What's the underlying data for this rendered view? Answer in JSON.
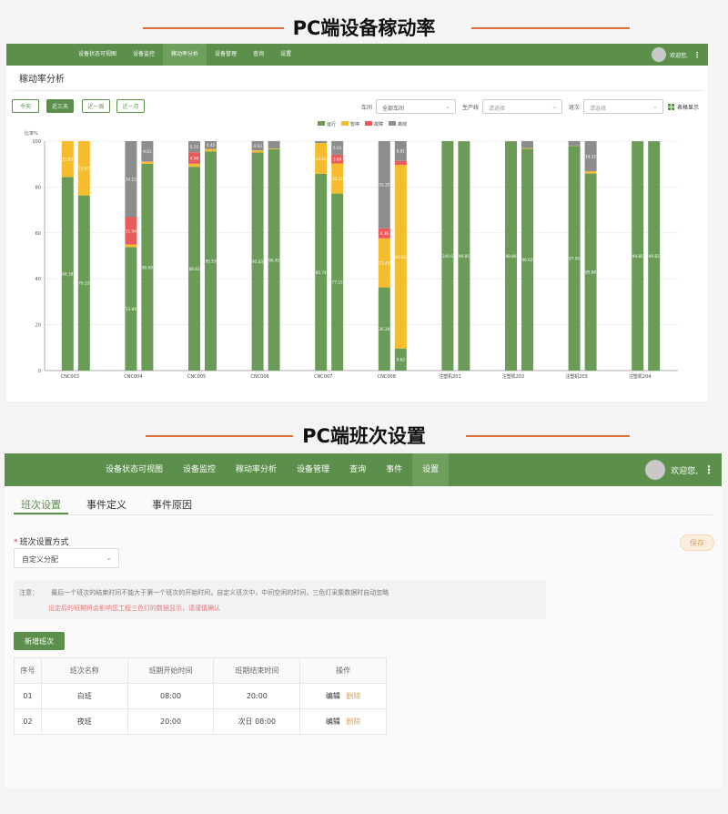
{
  "section1": {
    "title": "PC端设备稼动率"
  },
  "section2": {
    "title": "PC端班次设置"
  },
  "app1": {
    "nav": [
      "设备状态可视图",
      "设备监控",
      "稼动率分析",
      "设备管理",
      "查询",
      "设置"
    ],
    "active_nav": 2,
    "welcome": "欢迎您,",
    "pane_title": "稼动率分析",
    "range_buttons": [
      "今天",
      "近三天",
      "近一周",
      "近一月"
    ],
    "active_range": 1,
    "filters": {
      "workshop_label": "车间",
      "workshop_value": "全部车间",
      "line_label": "生产线",
      "line_placeholder": "请选择",
      "shift_label": "班次",
      "shift_placeholder": "请选择"
    },
    "table_view": "表格显示"
  },
  "chart_data": {
    "type": "bar",
    "stacked": true,
    "ylabel": "比率%",
    "ylim": [
      0,
      100
    ],
    "yticks": [
      0,
      20,
      40,
      60,
      80,
      100
    ],
    "legend_position": "top-center",
    "grid": true,
    "categories": [
      "CNC003",
      "CNC004",
      "CNC005",
      "CNC006",
      "CNC007",
      "CNC008",
      "注塑机201",
      "注塑机202",
      "注塑机203",
      "注塑机204"
    ],
    "series": [
      {
        "name": "运行",
        "color": "#6a9c58",
        "values": [
          [
            84.38,
            76.33
          ],
          [
            53.84,
            90.09
          ],
          [
            88.83,
            95.53
          ],
          [
            95.03,
            96.45
          ],
          [
            85.74,
            77.15
          ],
          [
            36.26,
            9.62
          ],
          [
            100.0,
            99.85
          ],
          [
            99.86,
            96.62
          ],
          [
            97.95,
            85.88
          ],
          [
            99.85,
            99.82
          ]
        ]
      },
      {
        "name": "暂停",
        "color": "#f5bd2e",
        "values": [
          [
            15.62,
            23.67
          ],
          [
            1.08,
            0.9
          ],
          [
            1.33,
            1.03
          ],
          [
            0.93,
            0.35
          ],
          [
            13.43,
            13.14
          ],
          [
            21.37,
            80.0
          ],
          [
            0,
            0.07
          ],
          [
            0.03,
            0.31
          ],
          [
            0.11,
            0.97
          ],
          [
            0,
            0
          ]
        ]
      },
      {
        "name": "故障",
        "color": "#ea5a5a",
        "values": [
          [
            0,
            0
          ],
          [
            11.94,
            0.19
          ],
          [
            4.96,
            0
          ],
          [
            0,
            0
          ],
          [
            0,
            3.8
          ],
          [
            4.36,
            1.74
          ],
          [
            0,
            0
          ],
          [
            0,
            0
          ],
          [
            0,
            0
          ],
          [
            0,
            0
          ]
        ]
      },
      {
        "name": "离线",
        "color": "#8d8d8d",
        "values": [
          [
            0,
            0
          ],
          [
            33.14,
            8.82
          ],
          [
            4.88,
            3.44
          ],
          [
            4.04,
            3.2
          ],
          [
            0.83,
            5.91
          ],
          [
            38.01,
            8.64
          ],
          [
            0,
            0.08
          ],
          [
            0.11,
            3.07
          ],
          [
            1.94,
            13.15
          ],
          [
            0.15,
            0.18
          ]
        ]
      }
    ],
    "bar_labels": [
      [
        [
          "84.38",
          "15.62",
          "",
          ""
        ],
        [
          "76.33",
          "23.67",
          "",
          ""
        ]
      ],
      [
        [
          "53.84",
          "",
          "11.94",
          "34.22"
        ],
        [
          "90.09",
          "",
          "",
          "9.61"
        ]
      ],
      [
        [
          "88.83",
          "",
          "4.96",
          "5.21"
        ],
        [
          "95.53",
          "",
          "",
          "4.45"
        ]
      ],
      [
        [
          "95.03",
          "",
          "",
          "4.93"
        ],
        [
          "96.45",
          "",
          "",
          ""
        ]
      ],
      [
        [
          "85.74",
          "13.43",
          "",
          ""
        ],
        [
          "77.15",
          "14.23",
          "3.80",
          "5.01"
        ]
      ],
      [
        [
          "36.26",
          "21.45",
          "4.36",
          "35.29"
        ],
        [
          "9.62",
          "80.02",
          "1.74",
          "8.81"
        ]
      ],
      [
        [
          "100.0",
          "",
          "",
          ""
        ],
        [
          "99.85",
          "",
          "",
          ""
        ]
      ],
      [
        [
          "99.86",
          "",
          "",
          ""
        ],
        [
          "96.62",
          "",
          "",
          ""
        ]
      ],
      [
        [
          "97.95",
          "",
          "",
          ""
        ],
        [
          "85.88",
          "",
          "",
          "14.32"
        ]
      ],
      [
        [
          "99.85",
          "",
          "",
          ""
        ],
        [
          "99.82",
          "",
          "",
          ""
        ]
      ]
    ]
  },
  "app2": {
    "nav": [
      "设备状态可视图",
      "设备监控",
      "稼动率分析",
      "设备管理",
      "查询",
      "事件",
      "设置"
    ],
    "active_nav": 6,
    "welcome": "欢迎您,",
    "subtabs": [
      "班次设置",
      "事件定义",
      "事件原因"
    ],
    "active_subtab": 0,
    "save": "保存",
    "mode_label": "班次设置方式",
    "mode_value": "自定义分配",
    "notice_prefix": "注意：",
    "notice_line1": "最后一个班次的结束时间不能大于第一个班次的开始时间，自定义班次中，中间空闲的时间，三色灯采集数据时自动忽略",
    "notice_line2": "设定后的班期将会影响您工程三色灯的数据显示，请谨慎确认",
    "add_button": "新增班次",
    "table": {
      "headers": [
        "序号",
        "班次名称",
        "班期开始时间",
        "班期结束时间",
        "操作"
      ],
      "rows": [
        {
          "no": "01",
          "name": "白班",
          "start": "08:00",
          "end": "20:00",
          "edit": "编辑",
          "delete": "删除"
        },
        {
          "no": "02",
          "name": "夜班",
          "start": "20:00",
          "end": "次日 08:00",
          "edit": "编辑",
          "delete": "删除"
        }
      ]
    }
  }
}
